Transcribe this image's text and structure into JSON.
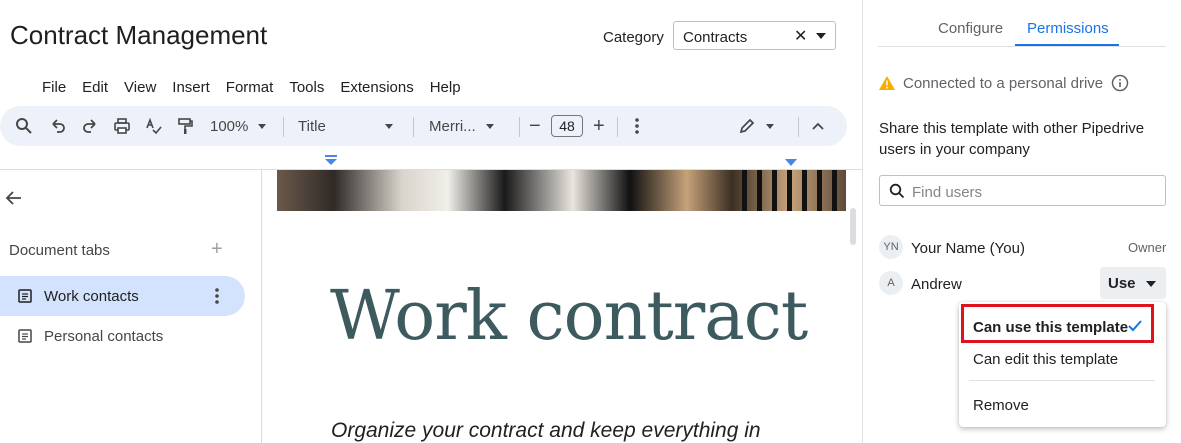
{
  "app": {
    "title": "Contract Management"
  },
  "category": {
    "label": "Category",
    "value": "Contracts",
    "clear_icon": "close-icon",
    "dropdown_icon": "caret-down-icon"
  },
  "menubar": [
    "File",
    "Edit",
    "View",
    "Insert",
    "Format",
    "Tools",
    "Extensions",
    "Help"
  ],
  "toolbar": {
    "zoom": "100%",
    "style": "Title",
    "font": "Merri...",
    "font_size": "48",
    "icons": [
      "search-icon",
      "undo-icon",
      "redo-icon",
      "print-icon",
      "spellcheck-icon",
      "paint-format-icon",
      "decrease-size-icon",
      "increase-size-icon",
      "more-icon",
      "edit-mode-icon",
      "collapse-icon"
    ]
  },
  "sidebar": {
    "section_label": "Document tabs",
    "add_icon": "plus-icon",
    "tabs": [
      {
        "label": "Work contacts",
        "active": true
      },
      {
        "label": "Personal contacts",
        "active": false
      }
    ]
  },
  "document": {
    "title": "Work contract",
    "subtitle": "Organize your contract and keep everything in"
  },
  "panel": {
    "tabs": [
      "Configure",
      "Permissions"
    ],
    "active_tab": "Permissions",
    "warning": "Connected to a personal drive",
    "share_text": "Share this template with other Pipedrive users in your company",
    "search_placeholder": "Find users",
    "users": [
      {
        "initials": "YN",
        "name": "Your Name (You)",
        "role": "Owner"
      },
      {
        "initials": "A",
        "name": "Andrew",
        "role": "Use"
      }
    ],
    "menu": {
      "items": [
        "Can use this template",
        "Can edit this template",
        "Remove"
      ],
      "selected": "Can use this template"
    }
  },
  "colors": {
    "accent": "#1a73e8",
    "highlight": "#e0121b",
    "warning": "#f9ab00",
    "title_color": "#3d5a5e"
  }
}
